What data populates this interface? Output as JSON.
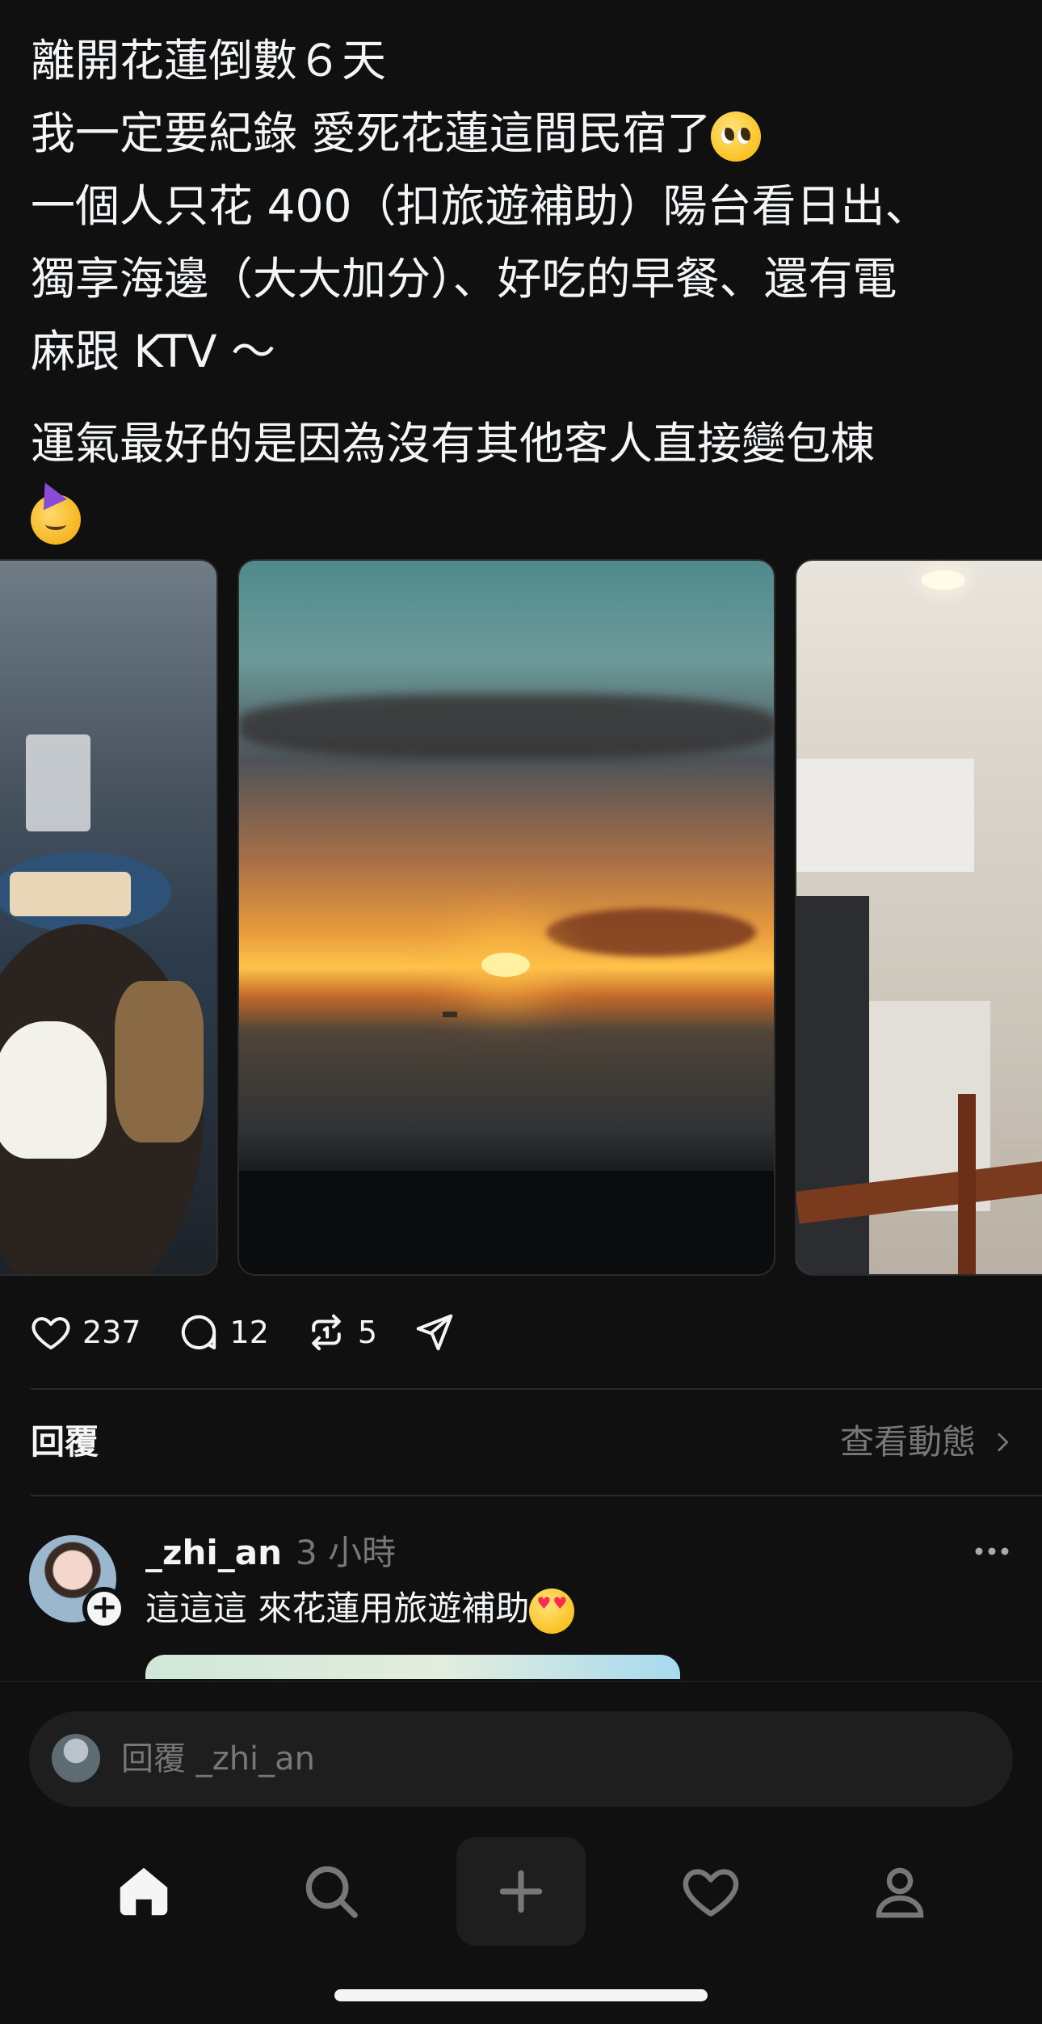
{
  "post": {
    "lines": [
      "離開花蓮倒數６天",
      "我一定要紀錄 愛死花蓮這間民宿了",
      "一個人只花 400（扣旅遊補助）陽台看日出、",
      "獨享海邊（大大加分）、好吃的早餐、還有電",
      "麻跟 KTV ～"
    ],
    "paragraph2": "運氣最好的是因為沒有其他客人直接變包棟",
    "emojis": [
      "pleading-face-emoji",
      "partying-face-emoji"
    ]
  },
  "carousel": {
    "photos": [
      {
        "name": "breakfast-photo",
        "subject": "breakfast"
      },
      {
        "name": "sunset-photo",
        "subject": "sunrise over sea"
      },
      {
        "name": "kitchen-photo",
        "subject": "kitchen interior"
      }
    ]
  },
  "actions": {
    "likes": "237",
    "comments": "12",
    "reposts": "5",
    "icons": [
      "heart-icon",
      "comment-icon",
      "repost-icon",
      "share-icon"
    ]
  },
  "replies_section": {
    "title": "回覆",
    "view_activity": "查看動態"
  },
  "reply": {
    "username": "_zhi_an",
    "time": "3 小時",
    "text": "這這這 來花蓮用旅遊補助"
  },
  "reply_input": {
    "placeholder": "回覆 _zhi_an"
  },
  "nav": {
    "items": [
      "home-icon",
      "search-icon",
      "create-icon",
      "activity-heart-icon",
      "profile-icon"
    ]
  },
  "colors": {
    "background": "#101010",
    "text": "#f3f5f7",
    "muted": "#777777",
    "surface": "#1e1e1e"
  }
}
